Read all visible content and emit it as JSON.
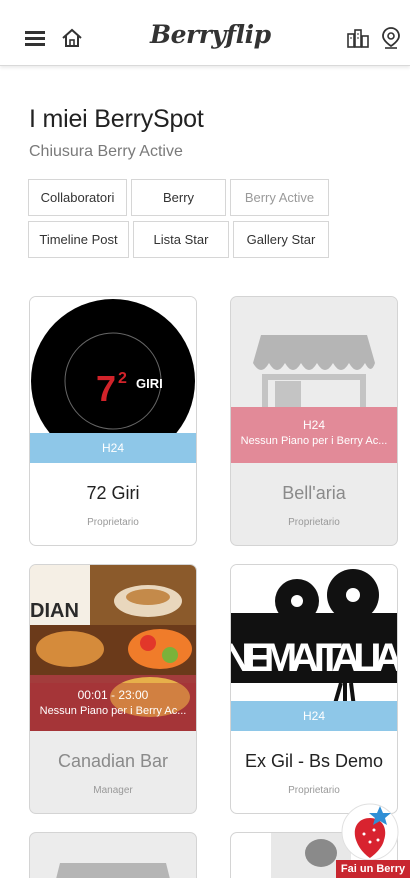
{
  "header": {
    "logo": "Berryflip",
    "icons": [
      "menu-icon",
      "home-icon",
      "city-icon",
      "location-pin-icon"
    ]
  },
  "page": {
    "title": "I miei BerrySpot",
    "subtitle": "Chiusura Berry Active"
  },
  "tabs": [
    {
      "label": "Collaboratori"
    },
    {
      "label": "Berry"
    },
    {
      "label": "Berry Active"
    },
    {
      "label": "Timeline Post"
    },
    {
      "label": "Lista Star"
    },
    {
      "label": "Gallery Star"
    }
  ],
  "spots": [
    {
      "name": "72 Giri",
      "role": "Proprietario",
      "band_line1": "H24",
      "band_line2": "",
      "logo_text": "GIRI",
      "logo_number": "7",
      "logo_exp": "2"
    },
    {
      "name": "Bell'aria",
      "role": "Proprietario",
      "band_line1": "H24",
      "band_line2": "Nessun Piano per i Berry Ac..."
    },
    {
      "name": "Canadian Bar",
      "role": "Manager",
      "band_line1": "00:01 - 23:00",
      "band_line2": "Nessun Piano per i Berry Ac...",
      "img_text": "DIAN"
    },
    {
      "name": "Ex Gil - Bs Demo",
      "role": "Proprietario",
      "band_line1": "H24",
      "band_line2": "",
      "img_text": "NEMA ITALIA"
    }
  ],
  "fab": {
    "label": "Fai un Berry"
  },
  "colors": {
    "band_blue": "#8ec7e8",
    "band_pink": "#e28a98",
    "fab_red": "#c8262f"
  }
}
